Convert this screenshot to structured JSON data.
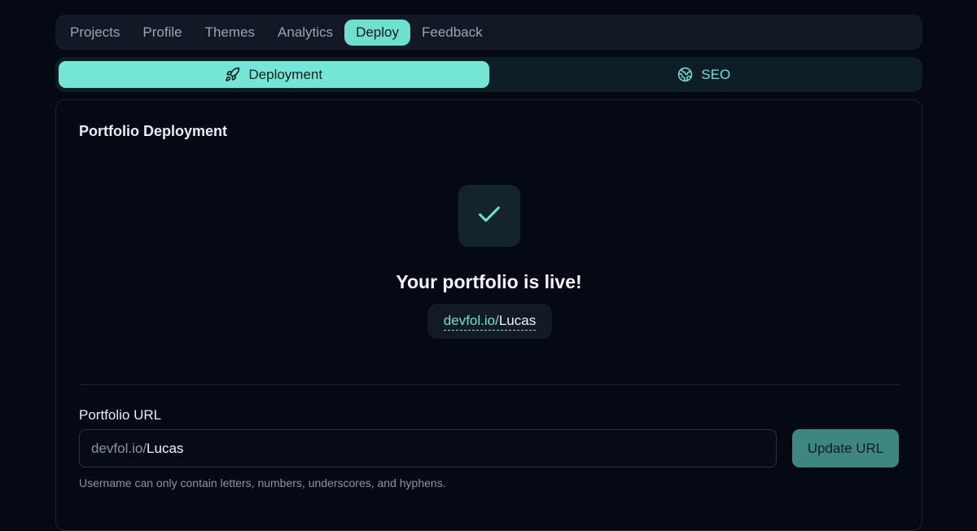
{
  "topnav": {
    "tabs": [
      {
        "label": "Projects"
      },
      {
        "label": "Profile"
      },
      {
        "label": "Themes"
      },
      {
        "label": "Analytics"
      },
      {
        "label": "Deploy",
        "active": true
      },
      {
        "label": "Feedback"
      }
    ]
  },
  "subnav": {
    "tabs": [
      {
        "label": "Deployment",
        "icon": "rocket-icon",
        "active": true
      },
      {
        "label": "SEO",
        "icon": "globe-icon"
      }
    ]
  },
  "card": {
    "title": "Portfolio Deployment",
    "status_icon": "check-icon",
    "live_message": "Your portfolio is live!",
    "live_url": {
      "domain": "devfol.io/",
      "username": "Lucas"
    }
  },
  "url_form": {
    "label": "Portfolio URL",
    "prefix": "devfol.io/",
    "value": "Lucas",
    "button_label": "Update URL",
    "hint": "Username can only contain letters, numbers, underscores, and hyphens."
  },
  "colors": {
    "accent": "#6ee0d0",
    "background": "#040914",
    "button": "#3e8682"
  }
}
